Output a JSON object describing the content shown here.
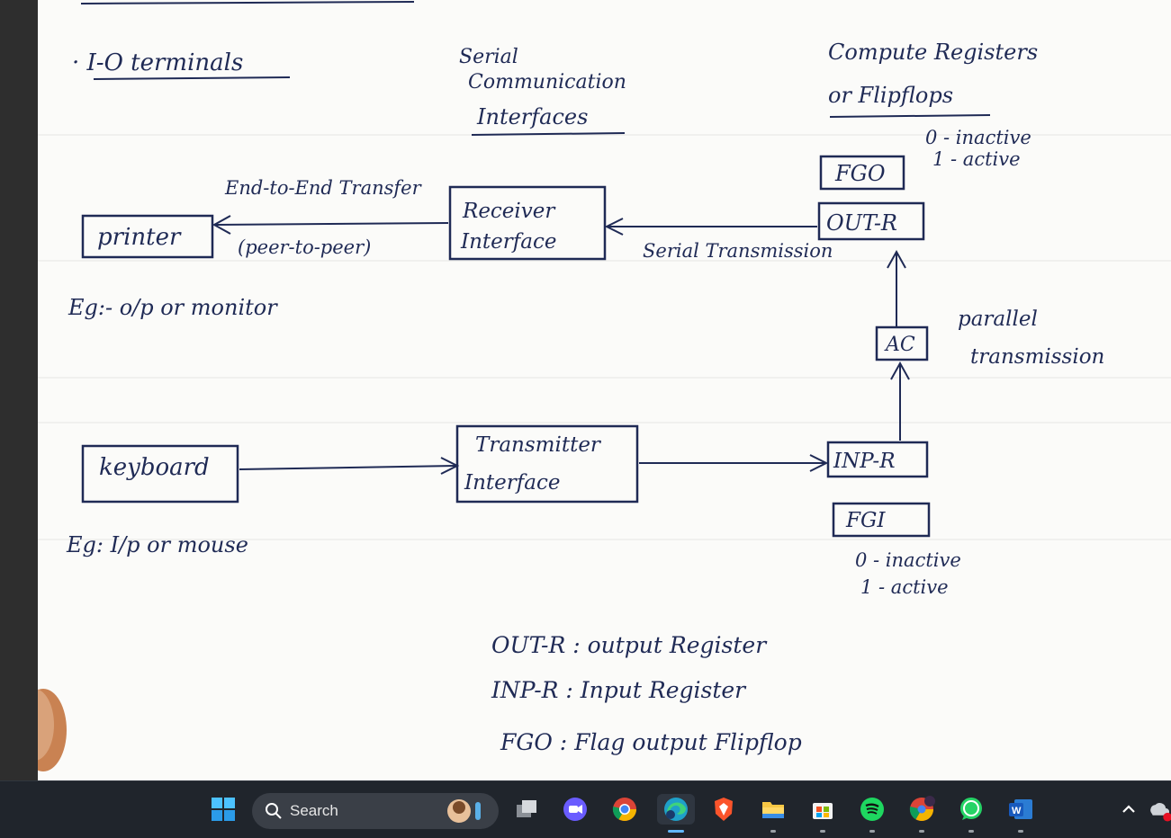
{
  "notes": {
    "io_terminals": "· I-O terminals",
    "serial_title_line1": "Serial",
    "serial_title_line2": "Communication",
    "serial_title_line3": "Interfaces",
    "compute_title_line1": "Compute Registers",
    "compute_title_line2": "or Flipflops",
    "fgo_state_0": "0 - inactive",
    "fgo_state_1": "1 - active",
    "fgo_box": "FGO",
    "out_r_box": "OUT-R",
    "end_to_end": "End-to-End Transfer",
    "peer_to_peer": "(peer-to-peer)",
    "printer_box": "printer",
    "receiver_line1": "Receiver",
    "receiver_line2": "Interface",
    "serial_transmission": "Serial Transmission",
    "eg_output": "Eg:- o/p or monitor",
    "ac_box": "AC",
    "parallel_line1": "parallel",
    "parallel_line2": "transmission",
    "keyboard_box": "keyboard",
    "transmitter_line1": "Transmitter",
    "transmitter_line2": "Interface",
    "inp_r_box": "INP-R",
    "fgi_box": "FGI",
    "fgi_state_0": "0 - inactive",
    "fgi_state_1": "1 - active",
    "eg_input": "Eg: I/p or mouse",
    "legend_out": "OUT-R : output Register",
    "legend_inp": "INP-R : Input Register",
    "legend_fgo": "FGO  :  Flag output Flipflop"
  },
  "taskbar": {
    "search_placeholder": "Search",
    "icons": [
      "windows-start-icon",
      "search-icon",
      "task-view-icon",
      "zoom-icon",
      "chrome-icon",
      "edge-icon",
      "brave-icon",
      "file-explorer-icon",
      "microsoft-store-icon",
      "spotify-icon",
      "chrome-profile-icon",
      "whatsapp-icon",
      "word-icon",
      "tray-chevron-icon",
      "onedrive-icon"
    ]
  }
}
